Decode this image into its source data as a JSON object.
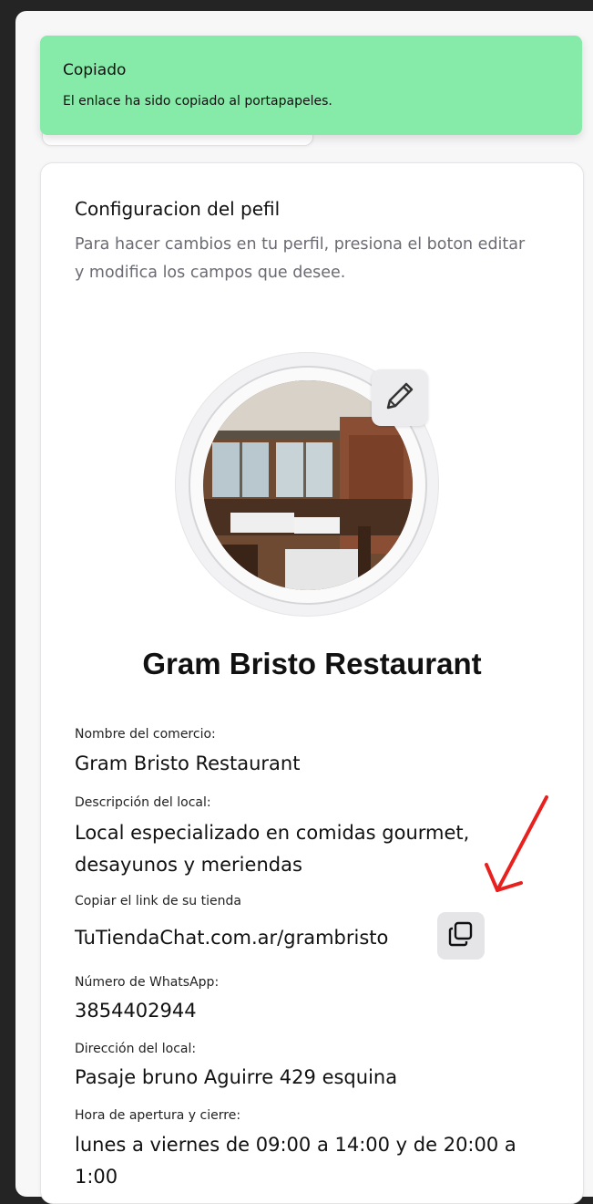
{
  "toast": {
    "title": "Copiado",
    "message": "El enlace ha sido copiado al portapapeles."
  },
  "profile": {
    "section_title": "Configuracion del pefil",
    "section_description": "Para hacer cambios en tu perfil, presiona el boton editar y modifica los campos que desee.",
    "business_title": "Gram Bristo Restaurant",
    "avatar_alt": "restaurant-interior-photo",
    "edit_icon": "pencil-icon",
    "copy_icon": "copy-icon"
  },
  "fields": {
    "name_label": "Nombre del comercio:",
    "name_value": "Gram Bristo Restaurant",
    "description_label": "Descripción del local:",
    "description_value": "Local especializado en comidas gourmet, desayunos y meriendas",
    "link_label": "Copiar el link de su tienda",
    "link_value": "TuTiendaChat.com.ar/grambristo",
    "whatsapp_label": "Número de WhatsApp:",
    "whatsapp_value": "3854402944",
    "address_label": "Dirección del local:",
    "address_value": "Pasaje bruno Aguirre 429 esquina",
    "hours_label": "Hora de apertura y cierre:",
    "hours_value": "lunes a viernes de 09:00 a 14:00 y de 20:00 a 1:00"
  },
  "colors": {
    "toast_bg": "#86eaa8",
    "annotation_arrow": "#e8201e"
  }
}
